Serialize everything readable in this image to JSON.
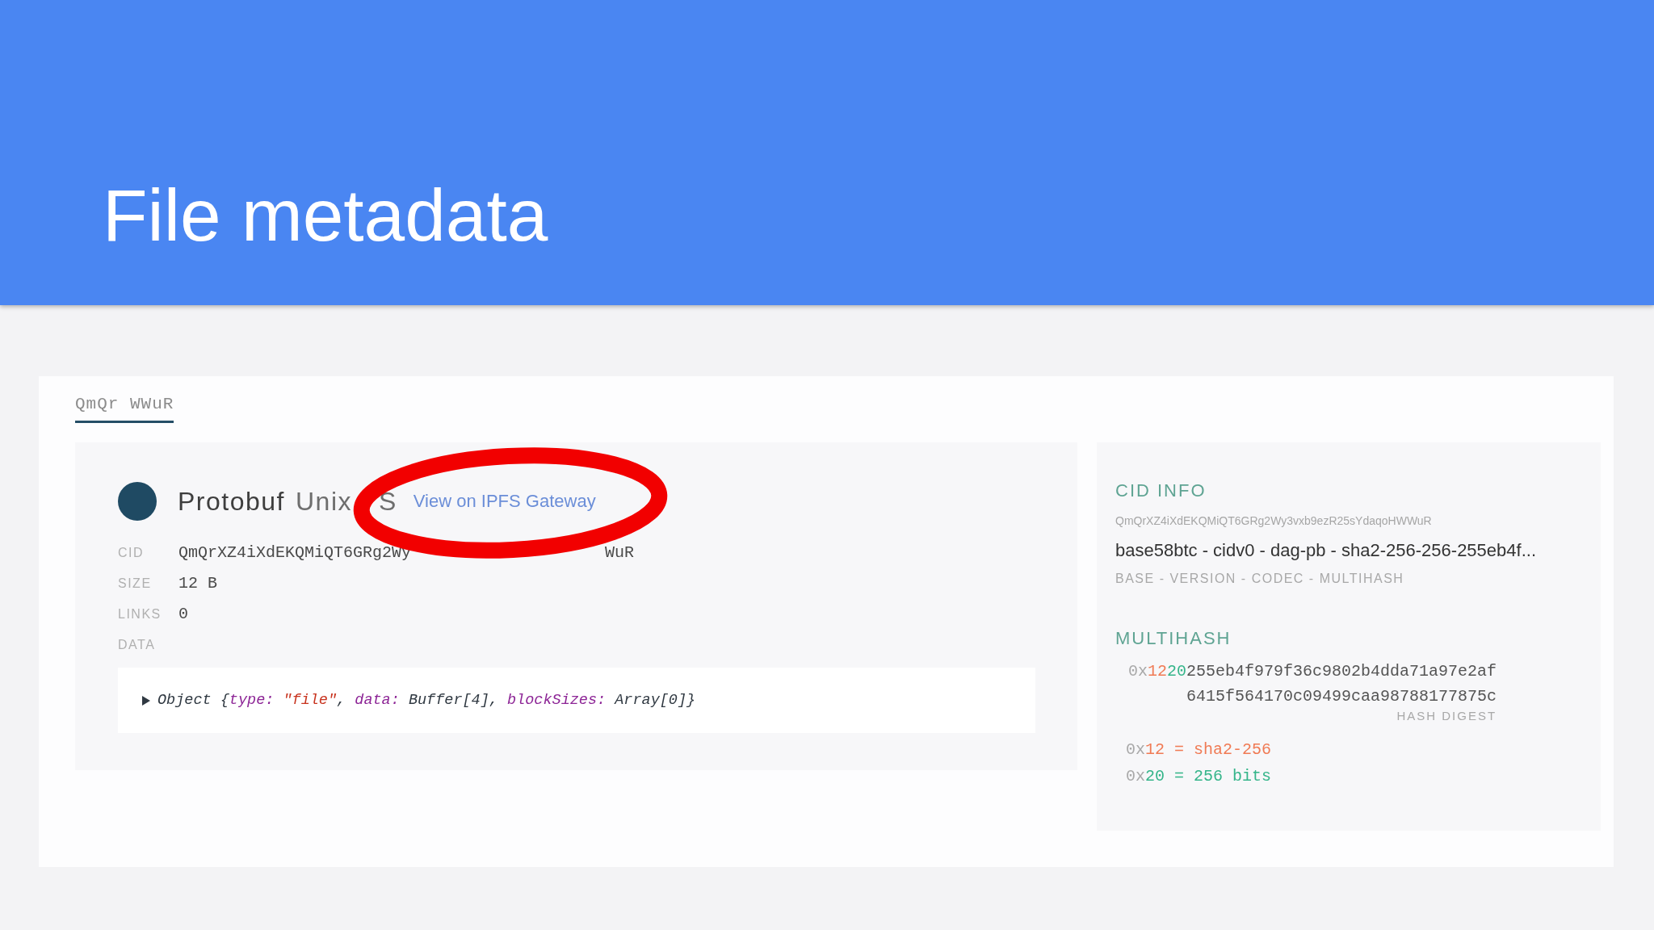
{
  "slide": {
    "title": "File metadata"
  },
  "tabs": [
    {
      "label": "QmQr WWuR",
      "selected": true
    }
  ],
  "node": {
    "type_label": "Protobuf",
    "format_label_parts": [
      "Unix",
      "S"
    ],
    "gateway_link": "View on IPFS Gateway",
    "fields": [
      {
        "label": "CID",
        "value_parts": [
          "QmQrXZ4iXdEKQMiQT6GRg2Wy",
          "WuR"
        ]
      },
      {
        "label": "SIZE",
        "value_parts": [
          "12 B"
        ]
      },
      {
        "label": "LINKS",
        "value_parts": [
          "0"
        ]
      },
      {
        "label": "DATA"
      }
    ],
    "data_preview": {
      "expanded": false,
      "tokens": [
        {
          "text": "Object {",
          "kind": "plain"
        },
        {
          "text": "type:",
          "kind": "key"
        },
        {
          "text": " \"file\"",
          "kind": "string"
        },
        {
          "text": ", ",
          "kind": "plain"
        },
        {
          "text": "data:",
          "kind": "key"
        },
        {
          "text": " Buffer[4], ",
          "kind": "plain"
        },
        {
          "text": "blockSizes:",
          "kind": "key"
        },
        {
          "text": " Array[0]}",
          "kind": "plain"
        }
      ]
    }
  },
  "cid_info": {
    "heading": "CID INFO",
    "cid": "QmQrXZ4iXdEKQMiQT6GRg2Wy3vxb9ezR25sYdaqoHWWuR",
    "summary": "base58btc - cidv0 - dag-pb - sha2-256-256-255eb4f...",
    "summary_legend": "BASE - VERSION - CODEC - MULTIHASH"
  },
  "multihash": {
    "heading": "MULTIHASH",
    "hash_parts": [
      {
        "text": "0x",
        "kind": "prefix"
      },
      {
        "text": "12",
        "kind": "code"
      },
      {
        "text": "20",
        "kind": "length"
      },
      {
        "text": "255eb4f979f36c9802b4dda71a97e2af6415f564170c09499caa98788177875c",
        "kind": "digest"
      }
    ],
    "digest_label": "HASH DIGEST",
    "decoded": [
      {
        "prefix": "0x",
        "text": "12 = sha2-256",
        "kind": "code"
      },
      {
        "prefix": "0x",
        "text": "20 = 256 bits",
        "kind": "length"
      }
    ]
  },
  "annotation": {
    "kind": "ellipse"
  }
}
